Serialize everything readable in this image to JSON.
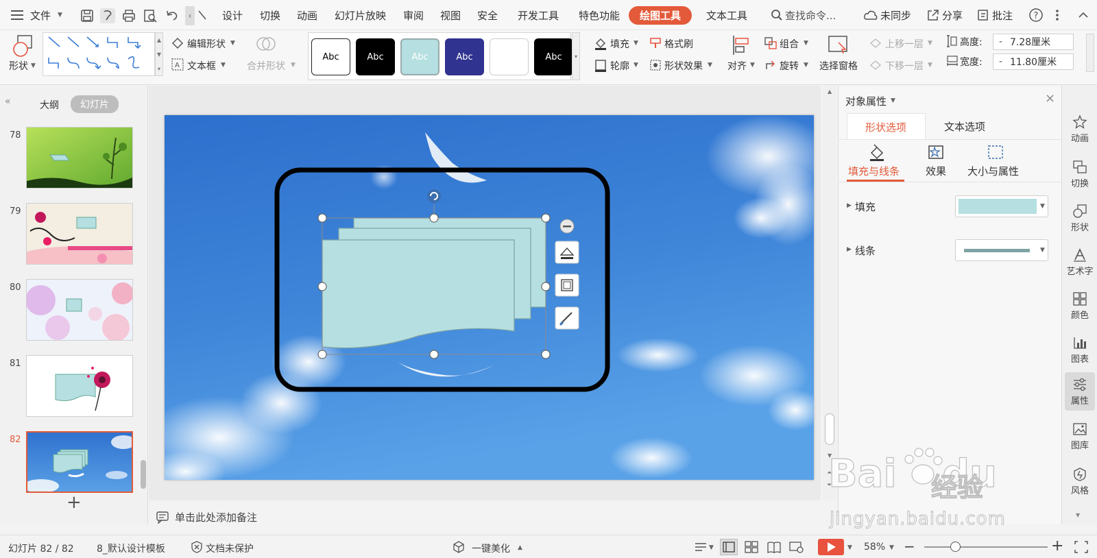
{
  "menubar": {
    "file": "文件",
    "tabs": [
      "设计",
      "切换",
      "动画",
      "幻灯片放映",
      "审阅",
      "视图",
      "安全",
      "开发工具",
      "特色功能",
      "绘图工具",
      "文本工具"
    ],
    "active_tab": "绘图工具",
    "search_placeholder": "查找命令...",
    "sync": "未同步",
    "share": "分享",
    "comment": "批注"
  },
  "ribbon": {
    "shape": "形状",
    "edit_shape": "编辑形状",
    "text_box": "文本框",
    "merge_shape": "合并形状",
    "style_label": "Abc",
    "fill": "填充",
    "format_brush": "格式刷",
    "outline": "轮廓",
    "shape_effect": "形状效果",
    "align": "对齐",
    "group": "组合",
    "rotate": "旋转",
    "select_pane": "选择窗格",
    "bring_forward": "上移一层",
    "send_backward": "下移一层",
    "height_label": "高度:",
    "height_value": "7.28厘米",
    "width_label": "宽度:",
    "width_value": "11.80厘米",
    "minus": "-"
  },
  "left_panel": {
    "outline_tab": "大纲",
    "slides_tab": "幻灯片",
    "slides": [
      {
        "number": "78"
      },
      {
        "number": "79"
      },
      {
        "number": "80"
      },
      {
        "number": "81"
      },
      {
        "number": "82"
      }
    ],
    "selected_slide": "82",
    "add": "+"
  },
  "notes": {
    "placeholder": "单击此处添加备注"
  },
  "right_panel": {
    "title": "对象属性",
    "tabs": [
      "形状选项",
      "文本选项"
    ],
    "subtabs": [
      "填充与线条",
      "效果",
      "大小与属性"
    ],
    "fill_label": "填充",
    "line_label": "线条",
    "fill_color": "#b5dfe0",
    "line_color": "#7fa3a3"
  },
  "right_bar": {
    "items": [
      "动画",
      "切换",
      "形状",
      "艺术字",
      "颜色",
      "图表",
      "属性",
      "图库",
      "风格"
    ],
    "active": "属性"
  },
  "status": {
    "slide_info": "幻灯片 82 / 82",
    "template": "8_默认设计模板",
    "protect": "文档未保护",
    "beautify": "一键美化",
    "zoom": "58%",
    "minus": "−",
    "plus": "+"
  },
  "watermark": {
    "text": "jingyan.baidu.com"
  },
  "colors": {
    "accent": "#e35a3a",
    "shape_fill": "#b5dfe0",
    "sky": "#3f86d9",
    "play": "#e8523e"
  }
}
